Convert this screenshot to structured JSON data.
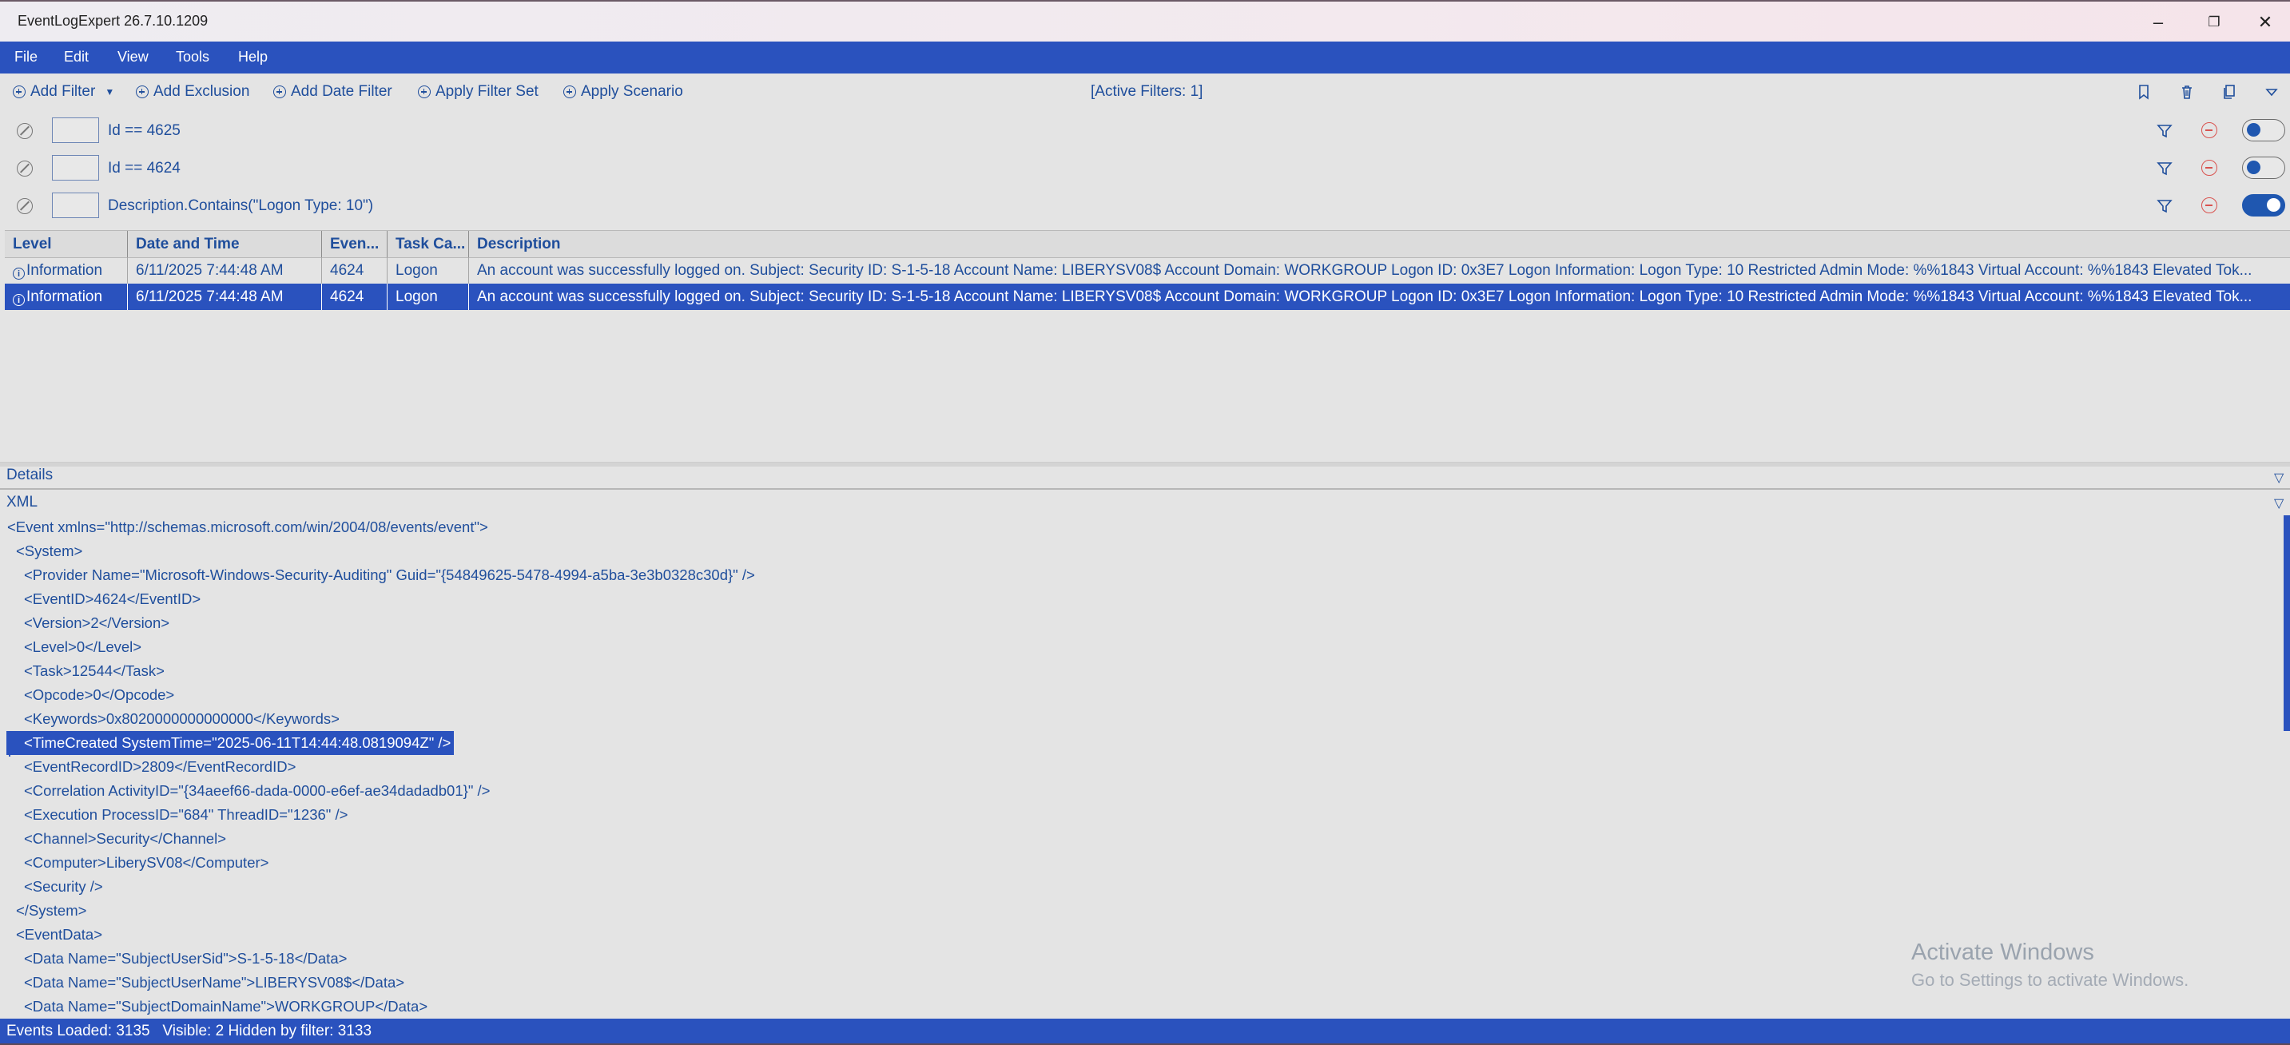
{
  "window": {
    "title": "EventLogExpert 26.7.10.1209",
    "min_glyph": "–",
    "max_glyph": "❐",
    "close_glyph": "✕"
  },
  "menu": [
    "File",
    "Edit",
    "View",
    "Tools",
    "Help"
  ],
  "toolbar": {
    "add_filter": "Add Filter",
    "add_exclusion": "Add Exclusion",
    "add_date_filter": "Add Date Filter",
    "apply_filter_set": "Apply Filter Set",
    "apply_scenario": "Apply Scenario",
    "active_filters": "[Active Filters: 1]"
  },
  "filters": [
    {
      "expression": "Id == 4625",
      "enabled": false
    },
    {
      "expression": "Id == 4624",
      "enabled": false
    },
    {
      "expression": "Description.Contains(\"Logon Type: 10\")",
      "enabled": true
    }
  ],
  "grid": {
    "columns": [
      "Level",
      "Date and Time",
      "Even...",
      "Task Ca...",
      "Description"
    ],
    "rows": [
      {
        "level": "Information",
        "datetime": "6/11/2025 7:44:48 AM",
        "event_id": "4624",
        "task": "Logon",
        "description": "An account was successfully logged on. Subject: Security ID: S-1-5-18 Account Name: LIBERYSV08$ Account Domain: WORKGROUP Logon ID: 0x3E7 Logon Information: Logon Type: 10 Restricted Admin Mode: %%1843 Virtual Account: %%1843 Elevated Tok...",
        "selected": false
      },
      {
        "level": "Information",
        "datetime": "6/11/2025 7:44:48 AM",
        "event_id": "4624",
        "task": "Logon",
        "description": "An account was successfully logged on. Subject: Security ID: S-1-5-18 Account Name: LIBERYSV08$ Account Domain: WORKGROUP Logon ID: 0x3E7 Logon Information: Logon Type: 10 Restricted Admin Mode: %%1843 Virtual Account: %%1843 Elevated Tok...",
        "selected": true
      }
    ]
  },
  "details": {
    "label": "Details",
    "xml_label": "XML",
    "lines": [
      {
        "text": "<Event xmlns=\"http://schemas.microsoft.com/win/2004/08/events/event\">",
        "indent": 0
      },
      {
        "text": "<System>",
        "indent": 1
      },
      {
        "text": "<Provider Name=\"Microsoft-Windows-Security-Auditing\" Guid=\"{54849625-5478-4994-a5ba-3e3b0328c30d}\" />",
        "indent": 2
      },
      {
        "text": "<EventID>4624</EventID>",
        "indent": 2
      },
      {
        "text": "<Version>2</Version>",
        "indent": 2
      },
      {
        "text": "<Level>0</Level>",
        "indent": 2
      },
      {
        "text": "<Task>12544</Task>",
        "indent": 2
      },
      {
        "text": "<Opcode>0</Opcode>",
        "indent": 2
      },
      {
        "text": "<Keywords>0x8020000000000000</Keywords>",
        "indent": 2
      },
      {
        "text": "<TimeCreated SystemTime=\"2025-06-11T14:44:48.0819094Z\" />",
        "indent": 2,
        "highlighted": true
      },
      {
        "text": "<EventRecordID>2809</EventRecordID>",
        "indent": 2
      },
      {
        "text": "<Correlation ActivityID=\"{34aeef66-dada-0000-e6ef-ae34dadadb01}\" />",
        "indent": 2
      },
      {
        "text": "<Execution ProcessID=\"684\" ThreadID=\"1236\" />",
        "indent": 2
      },
      {
        "text": "<Channel>Security</Channel>",
        "indent": 2
      },
      {
        "text": "<Computer>LiberySV08</Computer>",
        "indent": 2
      },
      {
        "text": "<Security />",
        "indent": 2
      },
      {
        "text": "</System>",
        "indent": 1
      },
      {
        "text": "<EventData>",
        "indent": 1
      },
      {
        "text": "<Data Name=\"SubjectUserSid\">S-1-5-18</Data>",
        "indent": 2
      },
      {
        "text": "<Data Name=\"SubjectUserName\">LIBERYSV08$</Data>",
        "indent": 2
      },
      {
        "text": "<Data Name=\"SubjectDomainName\">WORKGROUP</Data>",
        "indent": 2
      }
    ]
  },
  "watermark": {
    "line1": "Activate Windows",
    "line2": "Go to Settings to activate Windows."
  },
  "status": "Events Loaded: 3135   Visible: 2 Hidden by filter: 3133",
  "colors": {
    "accent": "#2a52be",
    "text": "#1f4e9c",
    "background": "#e4e4e4",
    "remove": "#d9534f"
  }
}
